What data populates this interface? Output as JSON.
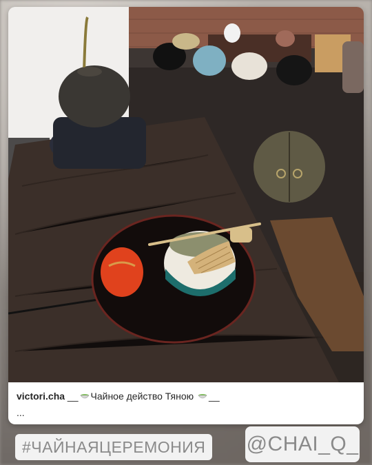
{
  "post": {
    "username": "victori.cha",
    "caption_prefix": "__",
    "caption_text": "Чайное действо Тяною",
    "caption_suffix": "__",
    "caption_more": "...",
    "photo_icon": "matcha-tea-ceremony-photo",
    "emoji_icon": "tea-bowl-emoji"
  },
  "stickers": {
    "hashtag": "#ЧАЙНАЯЦЕРЕМОНИЯ",
    "mention": "@CHAI_Q_"
  },
  "colors": {
    "sticker_bg": "#f2f2f2",
    "sticker_text": "#8a8a8a",
    "card_bg": "#ffffff"
  }
}
